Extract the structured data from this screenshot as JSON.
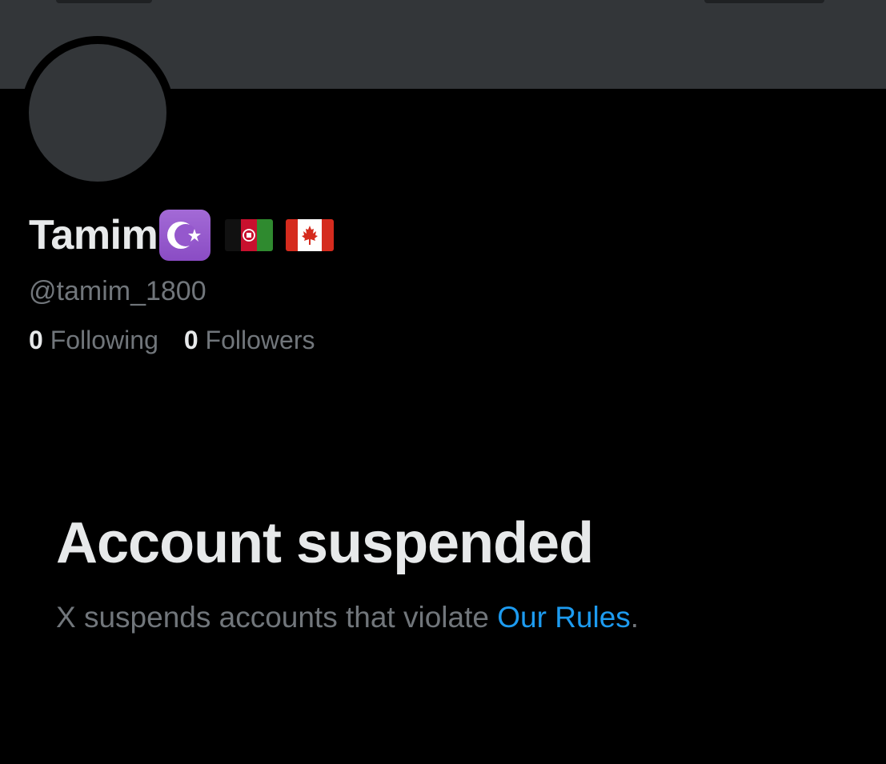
{
  "profile": {
    "display_name": "Tamim",
    "name_emojis": [
      "star-and-crescent-emoji",
      "afghanistan-flag-emoji",
      "canada-flag-emoji"
    ],
    "handle": "@tamim_1800",
    "following_count": "0",
    "following_label": "Following",
    "followers_count": "0",
    "followers_label": "Followers"
  },
  "suspension": {
    "title": "Account suspended",
    "description_prefix": "X suspends accounts that violate ",
    "rules_link": "Our Rules",
    "description_suffix": "."
  },
  "colors": {
    "background": "#000000",
    "banner": "#333639",
    "primary_text": "#e7e9ea",
    "secondary_text": "#71767b",
    "link": "#1d9bf0"
  }
}
